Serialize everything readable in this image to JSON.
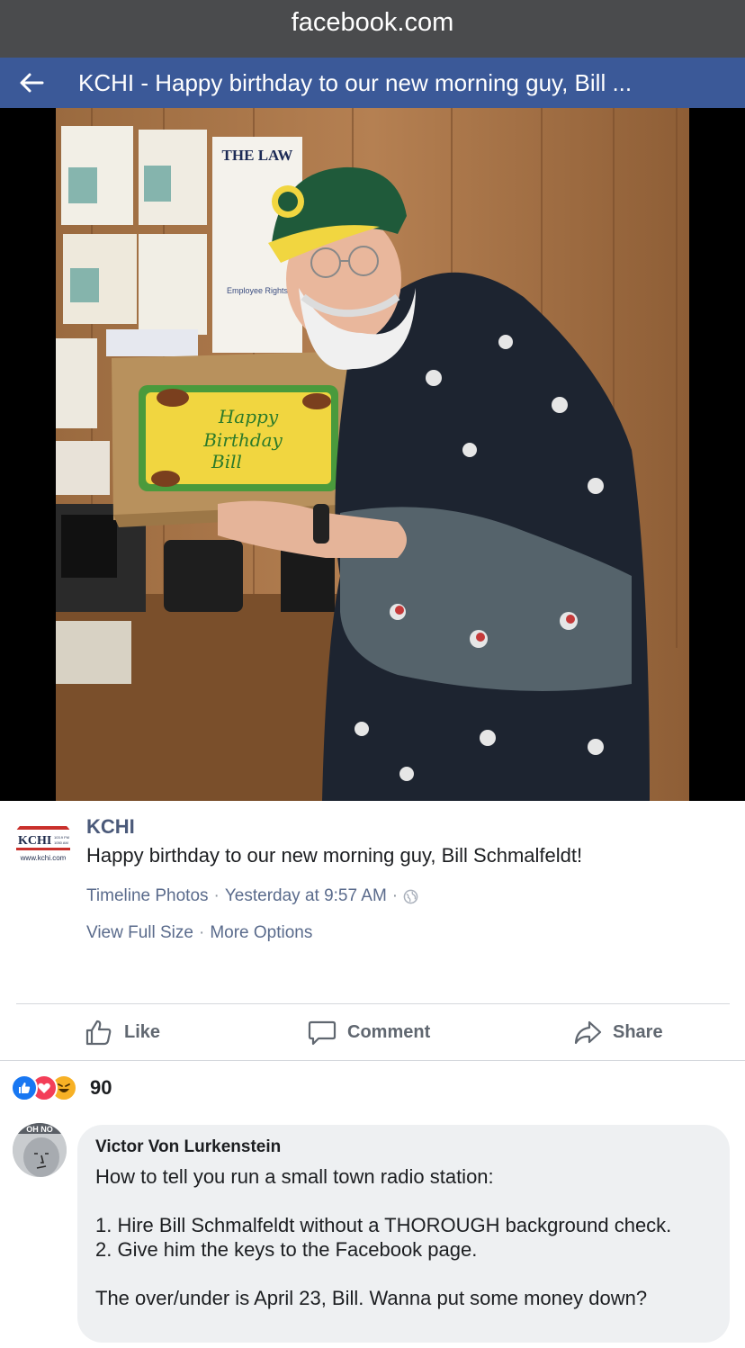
{
  "browser": {
    "url": "facebook.com"
  },
  "header": {
    "title": "KCHI - Happy birthday to our new morning guy, Bill ..."
  },
  "photo": {
    "cake_line1": "Happy",
    "cake_line2": "Birthday",
    "cake_line3": "Bill",
    "poster_text": "THE LAW",
    "poster_subtext": "Employee Rights"
  },
  "post": {
    "page_name": "KCHI",
    "avatar_logo": "KCHI",
    "avatar_freq1": "103.9 FM",
    "avatar_freq2": "1050 AM",
    "avatar_url": "www.kchi.com",
    "text": "Happy birthday to our new morning guy, Bill Schmalfeldt!",
    "album": "Timeline Photos",
    "separator": "·",
    "time": "Yesterday at 9:57 AM",
    "privacy_icon": "globe-icon",
    "view_full_size": "View Full Size",
    "more_options": "More Options"
  },
  "actions": {
    "like": "Like",
    "comment": "Comment",
    "share": "Share"
  },
  "reactions": {
    "types": [
      "like",
      "love",
      "haha"
    ],
    "count": "90"
  },
  "comment": {
    "avatar_text": "OH NO",
    "author": "Victor Von Lurkenstein",
    "line1": "How to tell you run a small town radio station:",
    "line2": "1. Hire Bill Schmalfeldt without a THOROUGH background check.",
    "line3": "2. Give him the keys to the Facebook page.",
    "line4": "The over/under is April 23, Bill. Wanna put some money down?"
  },
  "colors": {
    "header_bg": "#3b5998",
    "url_bar_bg": "#4a4b4d",
    "link_gray_blue": "#5a6b8c",
    "like_blue": "#1877f2",
    "love_red": "#f33e58",
    "haha_yellow": "#f7b125"
  }
}
